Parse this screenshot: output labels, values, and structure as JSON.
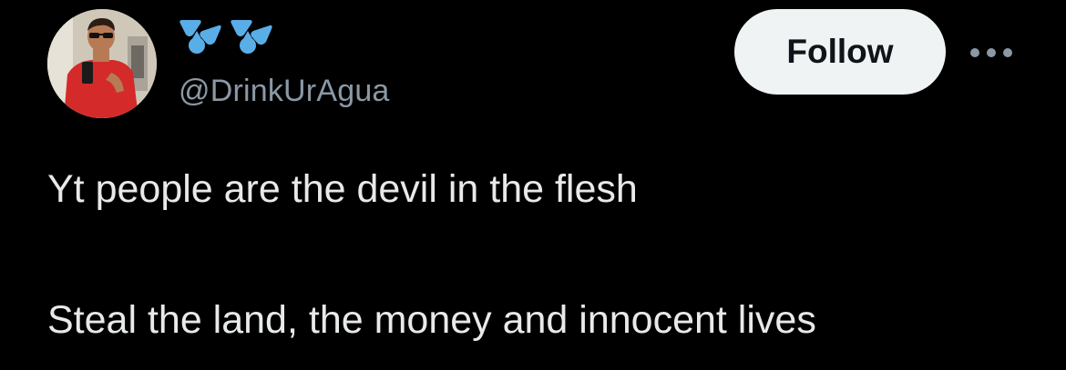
{
  "tweet": {
    "author": {
      "display_name_icon": "sweat-droplets-icon",
      "handle": "@DrinkUrAgua"
    },
    "follow_label": "Follow",
    "more_icon": "more-horizontal-icon",
    "text_lines": [
      "Yt people are the devil in the flesh",
      "Steal the land, the money and innocent lives"
    ]
  },
  "colors": {
    "background": "#000000",
    "text_primary": "#e7e9ea",
    "text_secondary": "#8b98a5",
    "button_bg": "#eff3f4",
    "button_text": "#0f1419",
    "emoji_blue": "#5aaee8"
  }
}
